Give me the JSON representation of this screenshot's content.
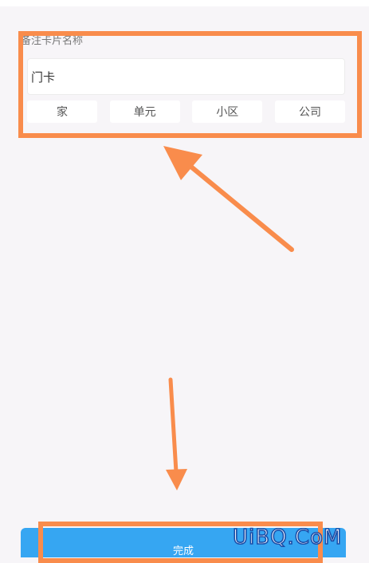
{
  "card_name": {
    "label": "备注卡片名称",
    "value": "门卡",
    "options": [
      "家",
      "单元",
      "小区",
      "公司"
    ]
  },
  "footer": {
    "done_label": "完成"
  },
  "watermark": "UiBQ.CoM",
  "colors": {
    "annotation": "#f98c4c",
    "button": "#36a6f2",
    "background": "#f7f5f8"
  }
}
